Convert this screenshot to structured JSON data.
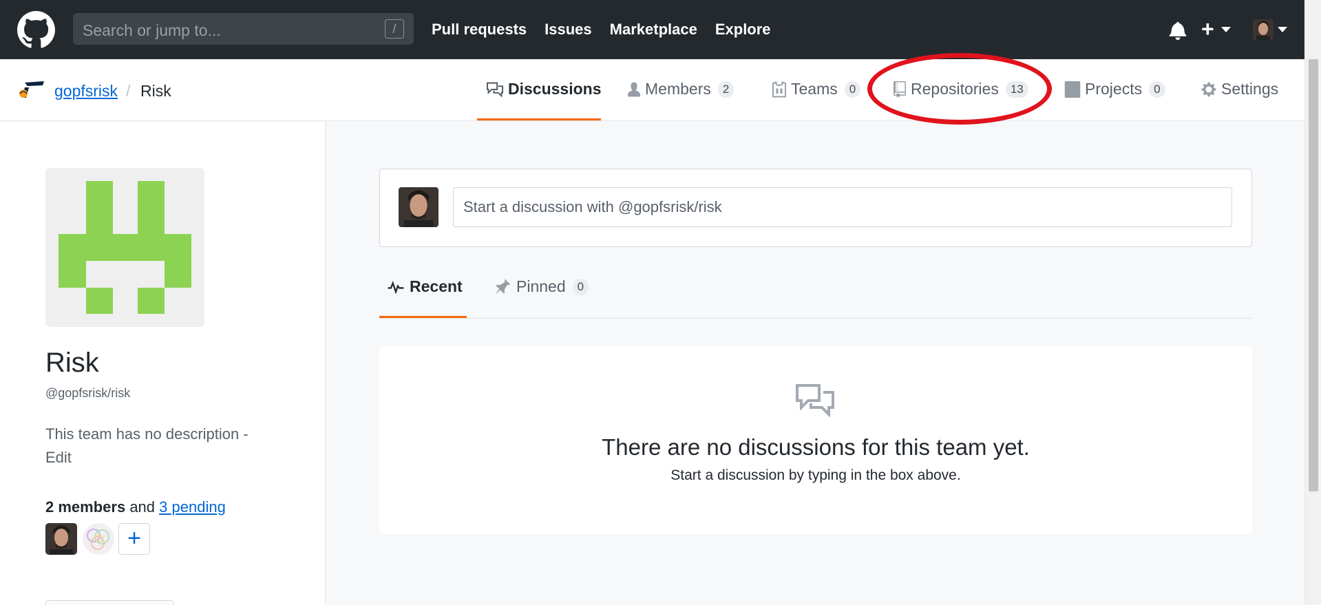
{
  "header": {
    "search_placeholder": "Search or jump to...",
    "search_shortcut": "/",
    "nav": [
      "Pull requests",
      "Issues",
      "Marketplace",
      "Explore"
    ],
    "plus_label": "+"
  },
  "breadcrumb": {
    "org": "gopfsrisk",
    "separator": "/",
    "team": "Risk"
  },
  "tabs": [
    {
      "label": "Discussions",
      "count": null,
      "icon": "comment-discussion-icon",
      "selected": true
    },
    {
      "label": "Members",
      "count": "2",
      "icon": "person-icon"
    },
    {
      "label": "Teams",
      "count": "0",
      "icon": "jersey-icon"
    },
    {
      "label": "Repositories",
      "count": "13",
      "icon": "repo-icon",
      "annotated": true
    },
    {
      "label": "Projects",
      "count": "0",
      "icon": "project-icon"
    },
    {
      "label": "Settings",
      "count": null,
      "icon": "gear-icon"
    }
  ],
  "annotation_color": "#e0131d",
  "sidebar": {
    "team_name": "Risk",
    "team_handle": "@gopfsrisk/risk",
    "description": "This team has no description - Edit",
    "members_count": "2 members",
    "members_and": "and",
    "pending": "3 pending",
    "add_member": "+"
  },
  "composer": {
    "placeholder": "Start a discussion with @gopfsrisk/risk"
  },
  "subtabs": [
    {
      "label": "Recent",
      "selected": true,
      "icon": "pulse-icon"
    },
    {
      "label": "Pinned",
      "count": "0",
      "icon": "pin-icon"
    }
  ],
  "empty_state": {
    "title": "There are no discussions for this team yet.",
    "subtitle": "Start a discussion by typing in the box above."
  },
  "colors": {
    "header_bg": "#24292e",
    "link": "#0366d6",
    "accent": "#f66a0a",
    "identicon": "#8cd354"
  }
}
